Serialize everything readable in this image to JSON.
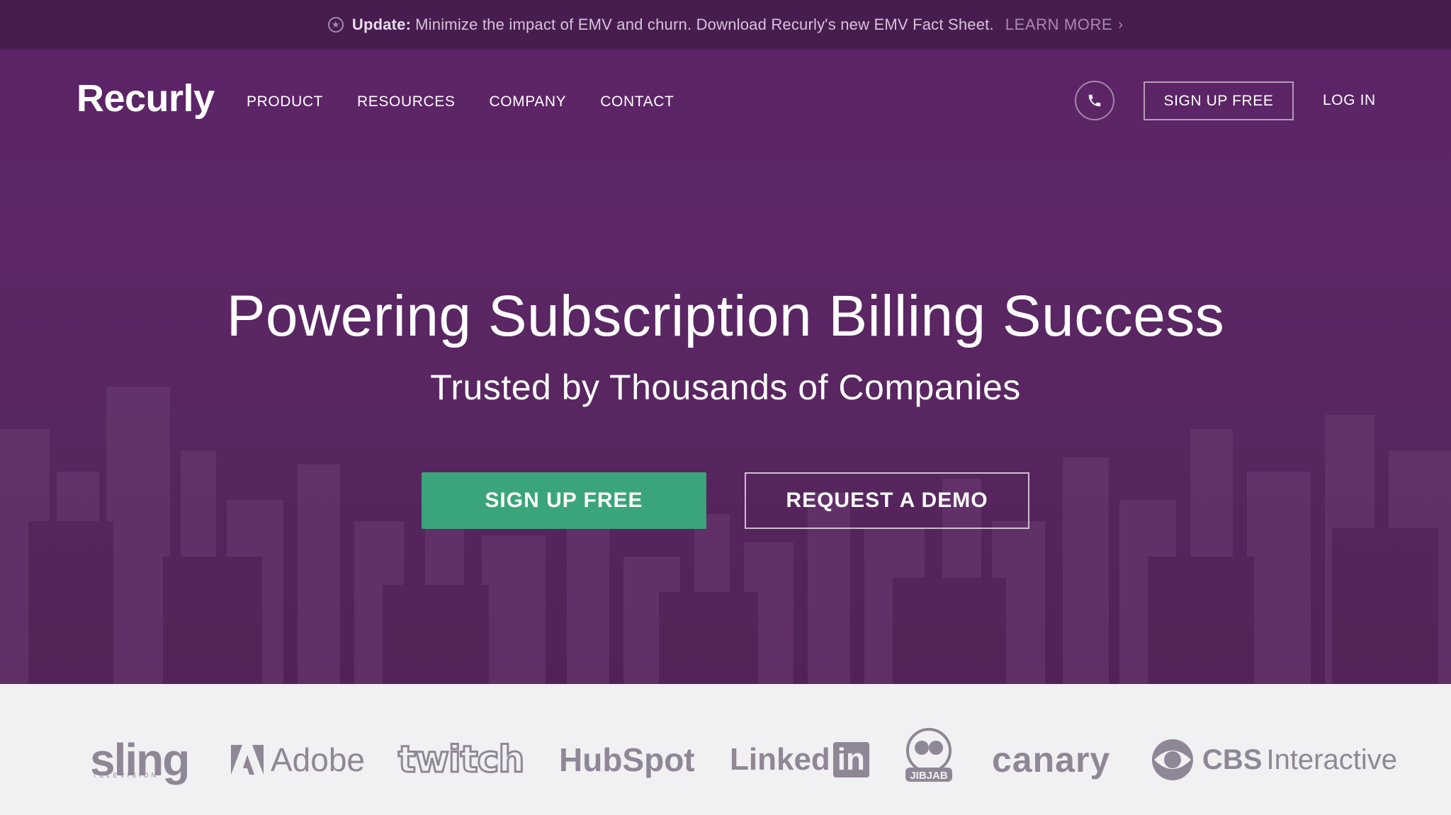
{
  "announcement": {
    "label": "Update:",
    "text": "Minimize the impact of EMV and churn. Download Recurly's new EMV Fact Sheet.",
    "link": "LEARN MORE",
    "icon": "star-icon"
  },
  "nav": {
    "logo": "Recurly",
    "links": [
      "PRODUCT",
      "RESOURCES",
      "COMPANY",
      "CONTACT"
    ],
    "phone_icon": "phone-icon",
    "signup": "SIGN UP FREE",
    "login": "LOG IN"
  },
  "hero": {
    "headline": "Powering Subscription Billing Success",
    "subhead": "Trusted by Thousands of Companies",
    "cta_primary": "SIGN UP FREE",
    "cta_secondary": "REQUEST A DEMO"
  },
  "customers": {
    "sling": "sling",
    "sling_sub": "TELEVISION",
    "adobe": "Adobe",
    "twitch": "twitch",
    "hubspot": "HubSpot",
    "linkedin_a": "Linked",
    "linkedin_b": "in",
    "jibjab": "JIBJAB",
    "canary": "canary",
    "cbs_a": "CBS",
    "cbs_b": "Interactive"
  },
  "colors": {
    "announcement_bg": "#471d4f",
    "hero_bg": "#5c2466",
    "primary_button": "#3aa57a",
    "logo_strip_bg": "#f1f0f2",
    "logo_gray": "#8f8796"
  }
}
